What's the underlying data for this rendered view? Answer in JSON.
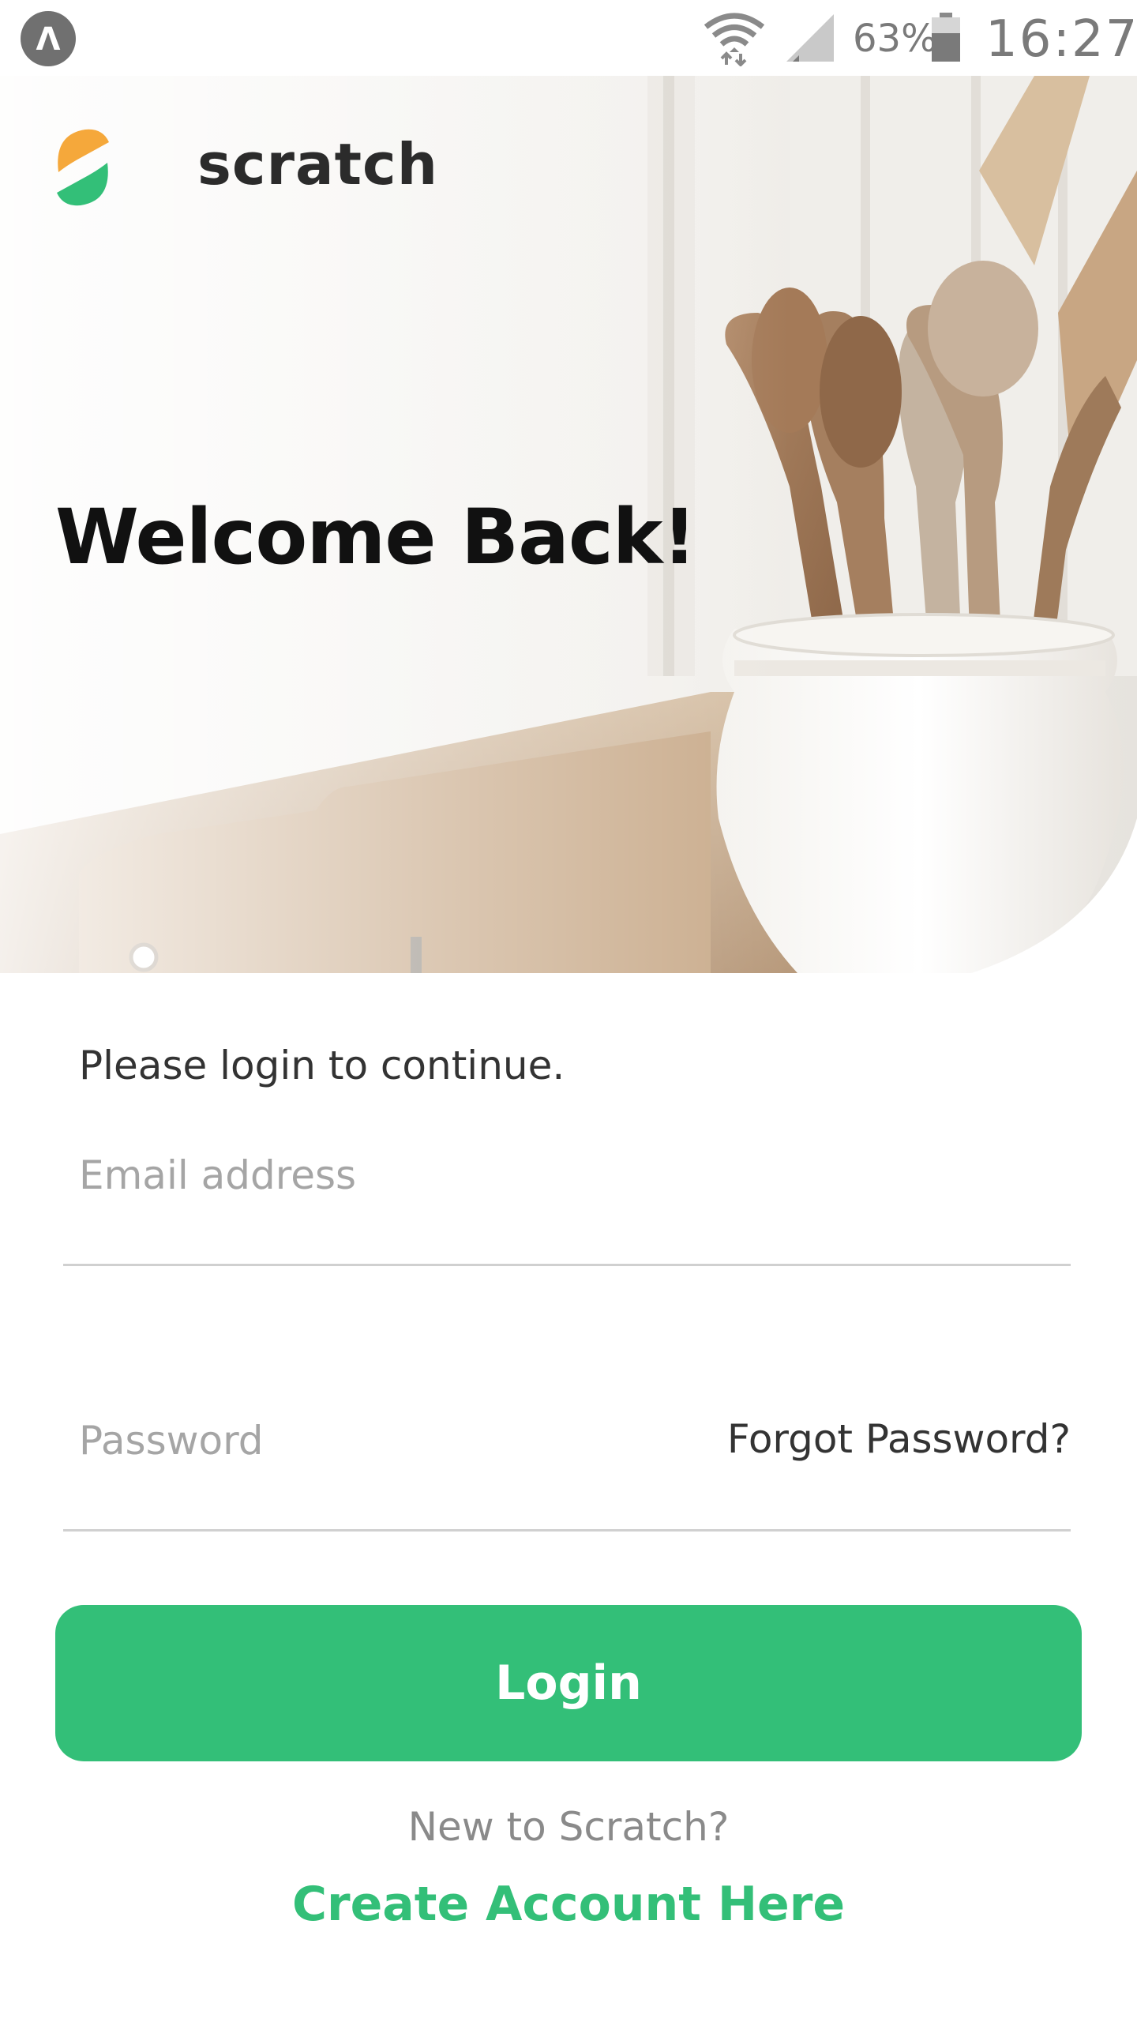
{
  "status_bar": {
    "app_badge": "Λ",
    "battery_percent": "63%",
    "time": "16:27",
    "icons": [
      "app-badge-icon",
      "wifi-icon",
      "cell-signal-icon",
      "battery-icon"
    ]
  },
  "header": {
    "brand_name": "scratch",
    "logo_icon": "scratch-logo-icon"
  },
  "hero": {
    "title": "Welcome Back!",
    "image": "kitchen-utensils-photo"
  },
  "form": {
    "intro": "Please login to continue.",
    "email_placeholder": "Email address",
    "password_placeholder": "Password",
    "forgot_password": "Forgot Password?",
    "login_label": "Login"
  },
  "signup": {
    "prompt": "New to Scratch?",
    "link_label": "Create Account Here"
  },
  "colors": {
    "accent_green": "#33bf78",
    "logo_orange": "#f5a83b",
    "logo_green": "#33bf78"
  }
}
